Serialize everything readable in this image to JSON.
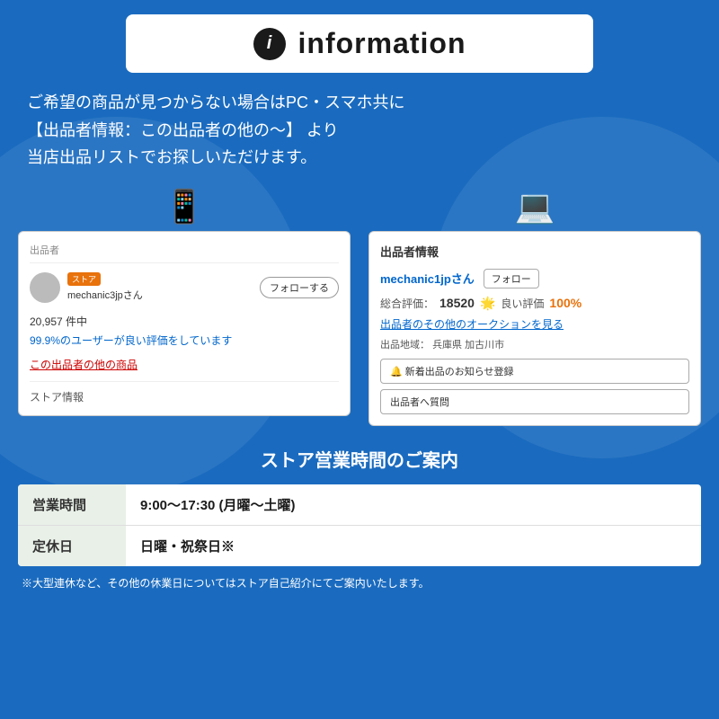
{
  "header": {
    "icon_label": "i",
    "title": "information"
  },
  "description": {
    "line1": "ご希望の商品が見つからない場合はPC・スマホ共に",
    "line2": "【出品者情報：この出品者の他の〜】 より",
    "line3": "当店出品リストでお探しいただけます。"
  },
  "mobile_screenshot": {
    "seller_label": "出品者",
    "store_badge": "ストア",
    "seller_name": "mechanic3jpさん",
    "follow_btn": "フォローする",
    "count": "20,957 件中",
    "rating_text": "99.9%のユーザーが良い評価をしています",
    "other_items_link": "この出品者の他の商品",
    "store_info_label": "ストア情報"
  },
  "pc_screenshot": {
    "section_title": "出品者情報",
    "seller_name": "mechanic1jpさん",
    "follow_btn": "フォロー",
    "rating_label": "総合評価：",
    "rating_count": "18520",
    "good_label": "良い評価",
    "good_pct": "100%",
    "auction_link": "出品者のその他のオークションを見る",
    "location_label": "出品地域：",
    "location_value": "兵庫県 加古川市",
    "notify_btn": "🔔 新着出品のお知らせ登録",
    "question_btn": "出品者へ質問"
  },
  "store_hours": {
    "title": "ストア営業時間のご案内",
    "rows": [
      {
        "label": "営業時間",
        "value": "9:00〜17:30 (月曜〜土曜)"
      },
      {
        "label": "定休日",
        "value": "日曜・祝祭日※"
      }
    ],
    "footer_note": "※大型連休など、その他の休業日についてはストア自己紹介にてご案内いたします。"
  },
  "colors": {
    "background": "#1a6bbf",
    "white": "#ffffff",
    "accent_orange": "#e8720c",
    "accent_blue": "#0066cc",
    "accent_red": "#cc0000",
    "label_bg": "#e8f0e8"
  }
}
